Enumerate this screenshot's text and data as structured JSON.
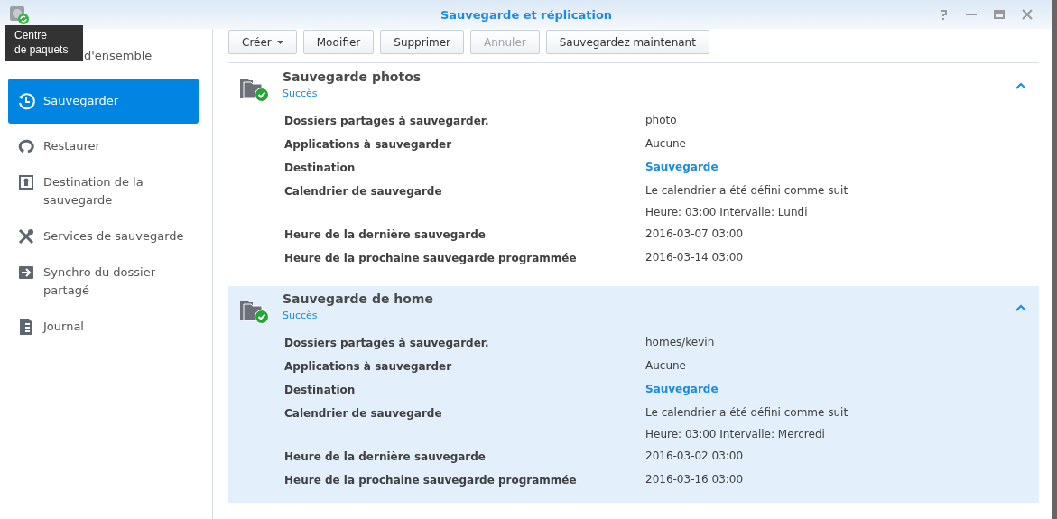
{
  "window": {
    "title": "Sauvegarde et réplication"
  },
  "tooltip": {
    "text": "Centre\nde paquets"
  },
  "sidebar": {
    "items": [
      {
        "label": "d'ensemble",
        "selected": false
      },
      {
        "label": "Sauvegarder",
        "selected": true
      },
      {
        "label": "Restaurer",
        "selected": false
      },
      {
        "label": "Destination de la sauvegarde",
        "selected": false
      },
      {
        "label": "Services de sauvegarde",
        "selected": false
      },
      {
        "label": "Synchro du dossier partagé",
        "selected": false
      },
      {
        "label": "Journal",
        "selected": false
      }
    ]
  },
  "toolbar": [
    {
      "label": "Créer",
      "dropdown": true,
      "disabled": false
    },
    {
      "label": "Modifier",
      "dropdown": false,
      "disabled": false
    },
    {
      "label": "Supprimer",
      "dropdown": false,
      "disabled": false
    },
    {
      "label": "Annuler",
      "dropdown": false,
      "disabled": true
    },
    {
      "label": "Sauvegardez maintenant",
      "dropdown": false,
      "disabled": false
    }
  ],
  "tasks": [
    {
      "name": "Sauvegarde photos",
      "status": "Succès",
      "selected": false,
      "expanded": true,
      "details": [
        {
          "label": "Dossiers partagés à sauvegarder.",
          "values": [
            "photo"
          ],
          "kind": "plain"
        },
        {
          "label": "Applications à sauvegarder",
          "values": [
            "Aucune"
          ],
          "kind": "plain"
        },
        {
          "label": "Destination",
          "values": [
            "Sauvegarde"
          ],
          "kind": "link"
        },
        {
          "label": "Calendrier de sauvegarde",
          "values": [
            "Le calendrier a été défini comme suit",
            "Heure: 03:00 Intervalle: Lundi"
          ],
          "kind": "plain"
        },
        {
          "label": "Heure de la dernière sauvegarde",
          "values": [
            "2016-03-07 03:00"
          ],
          "kind": "plain"
        },
        {
          "label": "Heure de la prochaine sauvegarde programmée",
          "values": [
            "2016-03-14 03:00"
          ],
          "kind": "plain"
        }
      ]
    },
    {
      "name": "Sauvegarde de home",
      "status": "Succès",
      "selected": true,
      "expanded": true,
      "details": [
        {
          "label": "Dossiers partagés à sauvegarder.",
          "values": [
            "homes/kevin"
          ],
          "kind": "plain"
        },
        {
          "label": "Applications à sauvegarder",
          "values": [
            "Aucune"
          ],
          "kind": "plain"
        },
        {
          "label": "Destination",
          "values": [
            "Sauvegarde"
          ],
          "kind": "link"
        },
        {
          "label": "Calendrier de sauvegarde",
          "values": [
            "Le calendrier a été défini comme suit",
            "Heure: 03:00 Intervalle: Mercredi"
          ],
          "kind": "plain"
        },
        {
          "label": "Heure de la dernière sauvegarde",
          "values": [
            "2016-03-02 03:00"
          ],
          "kind": "plain"
        },
        {
          "label": "Heure de la prochaine sauvegarde programmée",
          "values": [
            "2016-03-16 03:00"
          ],
          "kind": "plain"
        }
      ]
    }
  ]
}
